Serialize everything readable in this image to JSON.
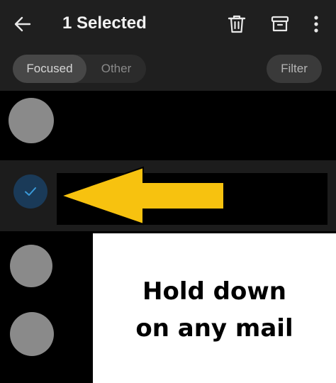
{
  "topbar": {
    "title": "1 Selected",
    "icons": [
      "back-arrow-icon",
      "trash-icon",
      "archive-icon",
      "more-vertical-icon"
    ]
  },
  "filters": {
    "focused_label": "Focused",
    "other_label": "Other",
    "selected": "Focused",
    "filter_label": "Filter"
  },
  "mail_list": {
    "items": [
      {
        "selected": false
      },
      {
        "selected": true
      },
      {
        "selected": false
      },
      {
        "selected": false
      }
    ]
  },
  "annotation": {
    "line1": "Hold down",
    "line2": "on any mail",
    "arrow_color": "#F7C20F"
  },
  "colors": {
    "bar_background": "#1f1f1f",
    "selected_row": "#1c1c1c",
    "check_accent": "#3a9ad9"
  }
}
